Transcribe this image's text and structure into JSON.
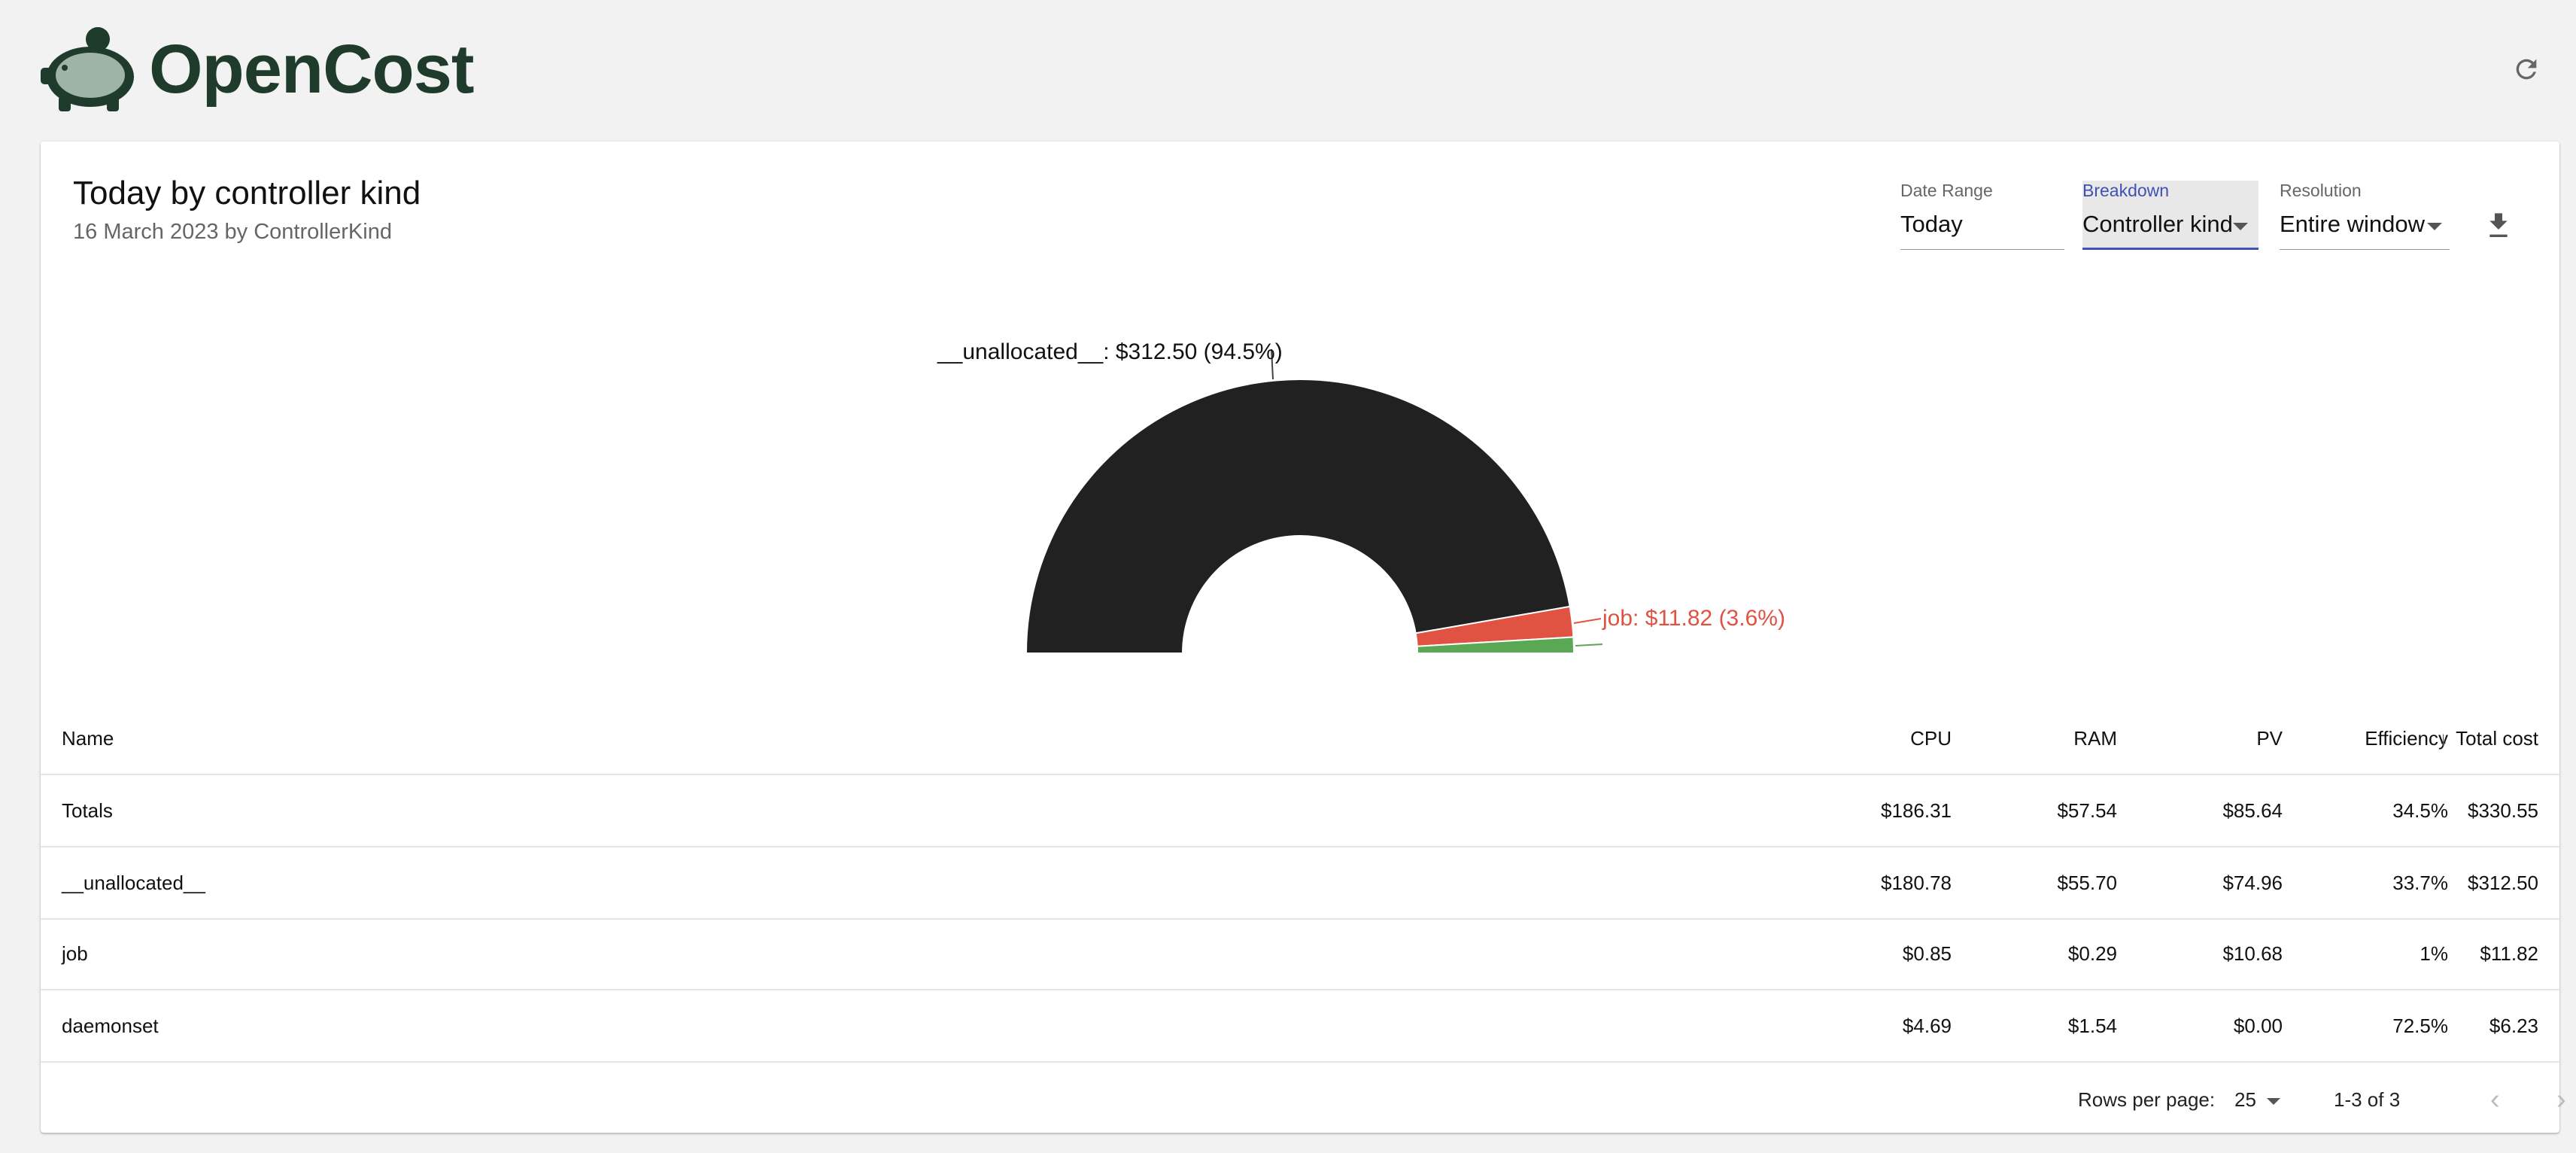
{
  "app": {
    "logo_text": "OpenCost"
  },
  "header": {
    "refresh_icon": "refresh-icon"
  },
  "report": {
    "title": "Today by controller kind",
    "subtitle": "16 March 2023 by ControllerKind"
  },
  "controls": {
    "date_range": {
      "label": "Date Range",
      "value": "Today"
    },
    "breakdown": {
      "label": "Breakdown",
      "value": "Controller kind"
    },
    "resolution": {
      "label": "Resolution",
      "value": "Entire window"
    },
    "download_icon": "download-icon"
  },
  "colors": {
    "unallocated": "#212121",
    "job": "#e05242",
    "daemonset": "#5aa854",
    "accent": "#3f51b5"
  },
  "chart_data": {
    "type": "pie",
    "style": "half-donut",
    "slices": [
      {
        "name": "__unallocated__",
        "value": 312.5,
        "percent": 94.5,
        "color": "#212121",
        "label": "__unallocated__: $312.50 (94.5%)"
      },
      {
        "name": "job",
        "value": 11.82,
        "percent": 3.6,
        "color": "#e05242",
        "label": "job: $11.82 (3.6%)"
      },
      {
        "name": "daemonset",
        "value": 6.23,
        "percent": 1.9,
        "color": "#5aa854",
        "label": ""
      }
    ]
  },
  "table": {
    "columns": {
      "name": "Name",
      "cpu": "CPU",
      "ram": "RAM",
      "pv": "PV",
      "efficiency": "Efficiency",
      "total": "Total cost"
    },
    "rows": [
      {
        "name": "Totals",
        "cpu": "$186.31",
        "ram": "$57.54",
        "pv": "$85.64",
        "efficiency": "34.5%",
        "total": "$330.55"
      },
      {
        "name": "__unallocated__",
        "cpu": "$180.78",
        "ram": "$55.70",
        "pv": "$74.96",
        "efficiency": "33.7%",
        "total": "$312.50"
      },
      {
        "name": "job",
        "cpu": "$0.85",
        "ram": "$0.29",
        "pv": "$10.68",
        "efficiency": "1%",
        "total": "$11.82"
      },
      {
        "name": "daemonset",
        "cpu": "$4.69",
        "ram": "$1.54",
        "pv": "$0.00",
        "efficiency": "72.5%",
        "total": "$6.23"
      }
    ]
  },
  "pagination": {
    "rows_per_page_label": "Rows per page:",
    "rows_per_page": "25",
    "range": "1-3 of 3"
  }
}
